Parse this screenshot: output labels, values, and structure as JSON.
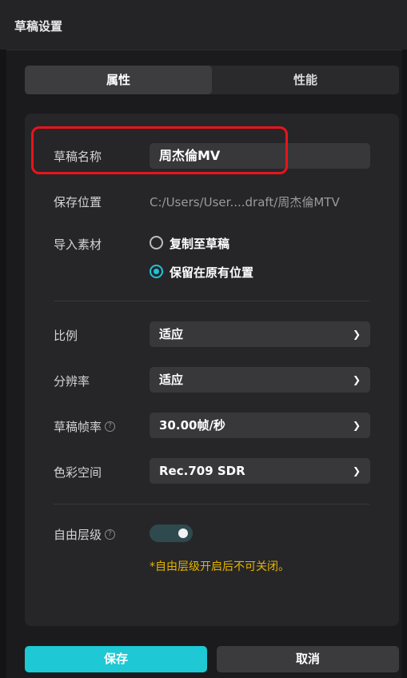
{
  "dialog": {
    "title": "草稿设置"
  },
  "tabs": [
    {
      "label": "属性"
    },
    {
      "label": "性能"
    }
  ],
  "fields": {
    "name": {
      "label": "草稿名称",
      "value": "周杰倫MV"
    },
    "save_location": {
      "label": "保存位置",
      "value": "C:/Users/User....draft/周杰倫MTV"
    },
    "import_material": {
      "label": "导入素材",
      "options": [
        {
          "label": "复制至草稿",
          "selected": false
        },
        {
          "label": "保留在原有位置",
          "selected": true
        }
      ]
    },
    "ratio": {
      "label": "比例",
      "value": "适应"
    },
    "resolution": {
      "label": "分辨率",
      "value": "适应"
    },
    "frame_rate": {
      "label": "草稿帧率",
      "value": "30.00帧/秒",
      "help_icon": "?"
    },
    "color_space": {
      "label": "色彩空间",
      "value": "Rec.709 SDR"
    },
    "free_layer": {
      "label": "自由层级",
      "help_icon": "?",
      "enabled": true,
      "note": "*自由层级开启后不可关闭。"
    }
  },
  "buttons": {
    "save": "保存",
    "cancel": "取消"
  },
  "colors": {
    "accent": "#1ec8d4",
    "highlight": "#e8141c",
    "warning": "#e3b400"
  }
}
